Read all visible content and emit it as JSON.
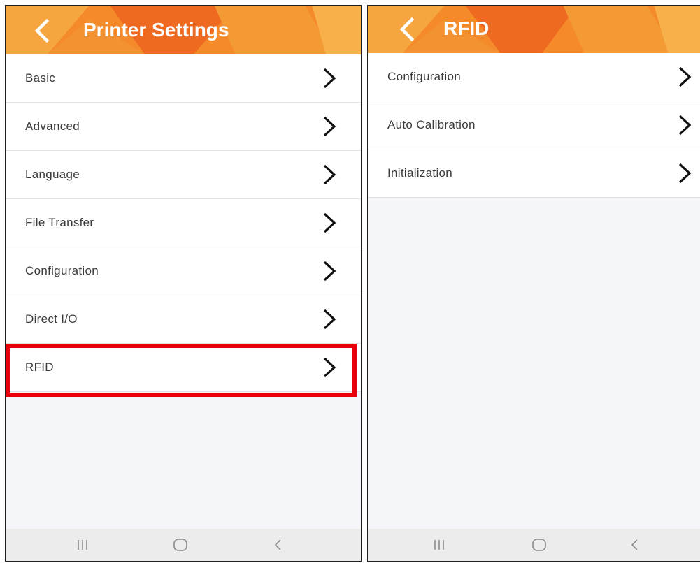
{
  "screens": {
    "left": {
      "title": "Printer Settings",
      "items": [
        {
          "label": "Basic"
        },
        {
          "label": "Advanced"
        },
        {
          "label": "Language"
        },
        {
          "label": "File Transfer"
        },
        {
          "label": "Configuration"
        },
        {
          "label": "Direct I/O"
        },
        {
          "label": "RFID"
        }
      ],
      "highlighted_item": "RFID"
    },
    "right": {
      "title": "RFID",
      "items": [
        {
          "label": "Configuration"
        },
        {
          "label": "Auto Calibration"
        },
        {
          "label": "Initialization"
        }
      ]
    }
  },
  "navbar": {
    "icons": [
      "recent-apps-icon",
      "home-icon",
      "back-nav-icon"
    ]
  },
  "colors": {
    "header_orange": "#f58a2a",
    "header_light": "#f6a640",
    "header_dark": "#ee6a20",
    "highlight": "#e8000a",
    "background": "#f4f5f9"
  },
  "icons": {
    "back": "chevron-left-icon",
    "item_arrow": "chevron-right-icon"
  }
}
